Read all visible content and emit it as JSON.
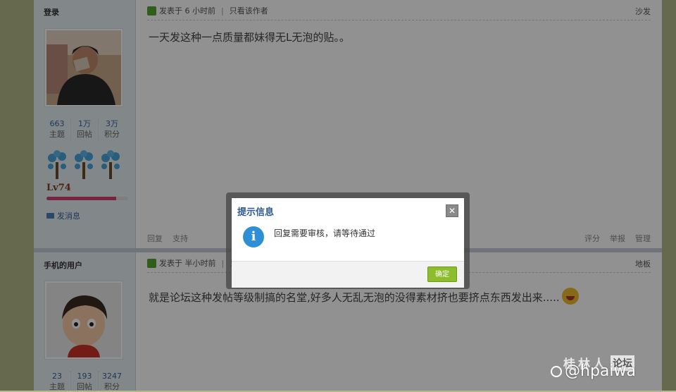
{
  "posts": [
    {
      "username": "登录",
      "stats": [
        {
          "value": "663",
          "label": "主题"
        },
        {
          "value": "1万",
          "label": "回帖"
        },
        {
          "value": "3万",
          "label": "积分"
        }
      ],
      "level": "Lv74",
      "level_progress": 0.85,
      "send_message": "发消息",
      "posted_at": "发表于 6 小时前",
      "author_only": "只看该作者",
      "floor": "沙发",
      "body": "一天发这种一点质量都妹得无L无泡的贴。。",
      "actions_left": [
        "回复",
        "支持"
      ],
      "actions_right": [
        "评分",
        "举报",
        "管理"
      ]
    },
    {
      "username": "手机的用户",
      "stats": [
        {
          "value": "23",
          "label": "主题"
        },
        {
          "value": "193",
          "label": "回帖"
        },
        {
          "value": "3247",
          "label": "积分"
        }
      ],
      "posted_at": "发表于 半小时前",
      "author_only": "只",
      "floor": "地板",
      "body": "就是论坛这种发帖等级制搞的名堂,好多人无乱无泡的没得素材挤也要挤点东西发出来....."
    }
  ],
  "dialog": {
    "title": "提示信息",
    "close": "✕",
    "message": "回复需要审核，请等待通过",
    "confirm": "确定"
  },
  "watermark": {
    "site": "桂林人",
    "box": "论坛",
    "handle": "@hpaiwa"
  }
}
